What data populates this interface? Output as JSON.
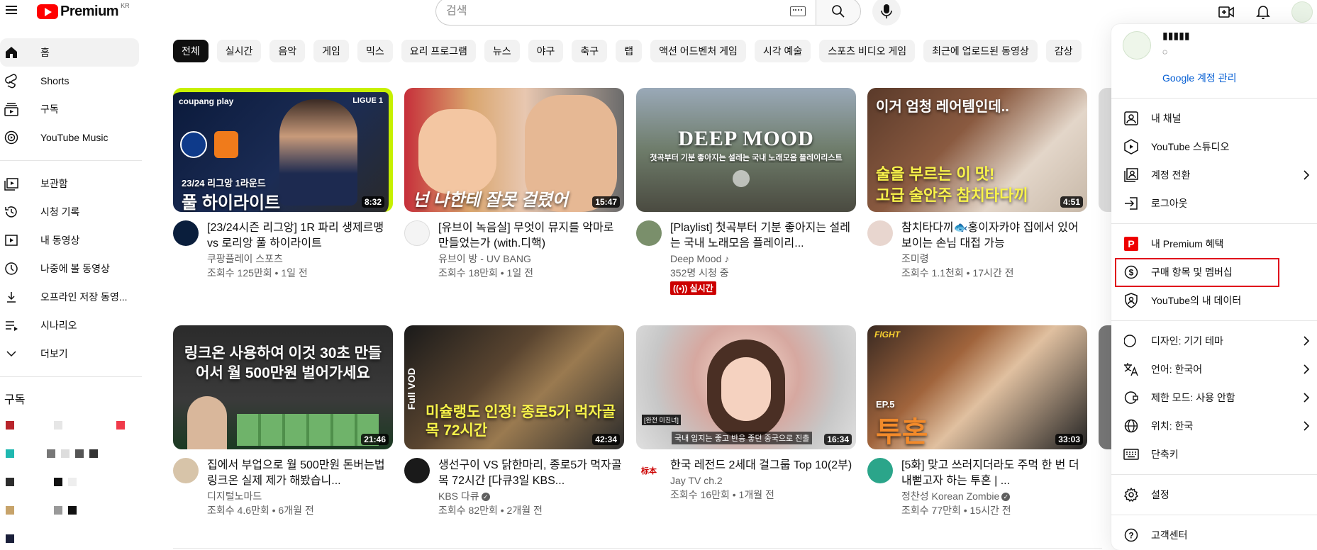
{
  "masthead": {
    "logo_text": "Premium",
    "logo_region": "KR",
    "search_placeholder": "검색",
    "icons": [
      "menu-icon",
      "keyboard-icon",
      "search-icon",
      "mic-icon",
      "create-video-icon",
      "bell-icon",
      "avatar"
    ]
  },
  "sidebar": {
    "items": [
      {
        "label": "홈",
        "icon": "home-icon",
        "active": true
      },
      {
        "label": "Shorts",
        "icon": "shorts-icon"
      },
      {
        "label": "구독",
        "icon": "subscriptions-icon"
      },
      {
        "label": "YouTube Music",
        "icon": "youtube-music-icon"
      }
    ],
    "library": [
      {
        "label": "보관함",
        "icon": "library-icon"
      },
      {
        "label": "시청 기록",
        "icon": "history-icon"
      },
      {
        "label": "내 동영상",
        "icon": "your-videos-icon"
      },
      {
        "label": "나중에 볼 동영상",
        "icon": "watch-later-icon"
      },
      {
        "label": "오프라인 저장 동영...",
        "icon": "download-icon"
      },
      {
        "label": "시나리오",
        "icon": "playlist-icon"
      },
      {
        "label": "더보기",
        "icon": "chevron-down-icon"
      }
    ],
    "subscriptions_title": "구독"
  },
  "chips": [
    "전체",
    "실시간",
    "음악",
    "게임",
    "믹스",
    "요리 프로그램",
    "뉴스",
    "야구",
    "축구",
    "랩",
    "액션 어드벤처 게임",
    "시각 예술",
    "스포츠 비디오 게임",
    "최근에 업로드된 동영상",
    "감상"
  ],
  "videos": [
    {
      "title": "[23/24시즌 리그앙] 1R 파리 생제르맹 vs 로리앙 풀 하이라이트",
      "channel": "쿠팡플레이 스포츠",
      "stats": "조회수 125만회 • 1일 전",
      "duration": "8:32",
      "thumb_text": "풀 하이라이트",
      "thumb_sub": "23/24 리그앙 1라운드",
      "thumb_brand": "coupang play",
      "thumb_league": "LIGUE 1"
    },
    {
      "title": "[유브이 녹음실] 무엇이 뮤지를 악마로 만들었는가 (with.디핵)",
      "channel": "유브이 방 - UV BANG",
      "stats": "조회수 18만회 • 1일 전",
      "duration": "15:47",
      "thumb_text": "넌 나한테 잘못 걸렸어"
    },
    {
      "title": "[Playlist] 첫곡부터 기분 좋아지는 설레는 국내 노래모음 플레이리...",
      "channel": "Deep Mood ♪",
      "stats": "352명 시청 중",
      "live": "실시간",
      "thumb_text": "DEEP MOOD",
      "thumb_sub": "첫곡부터 기분 좋아지는 설레는 국내 노래모음 플레이리스트"
    },
    {
      "title": "참치타다끼🐟홍이자카야 집에서 있어 보이는 손님 대접 가능",
      "channel": "조미령",
      "stats": "조회수 1.1천회 • 17시간 전",
      "duration": "4:51",
      "thumb_text": "고급 술안주 참치타다끼",
      "thumb_sub": "술을 부르는 이 맛!",
      "thumb_top": "이거 엄청 레어템인데.."
    },
    {
      "title": "집에서 부업으로 월 500만원 돈버는법 링크온 실제 제가 해봤습니...",
      "channel": "디지털노마드",
      "stats": "조회수 4.6만회 • 6개월 전",
      "duration": "21:46",
      "thumb_text": "링크온 사용하여 이것 30초 만들어서 월 500만원 벌어가세요"
    },
    {
      "title": "생선구이 VS 닭한마리, 종로5가 먹자골목 72시간 [다큐3일 KBS...",
      "channel": "KBS 다큐",
      "stats": "조회수 82만회 • 2개월 전",
      "duration": "42:34",
      "thumb_text": "미슐랭도 인정! 종로5가 먹자골목 72시간",
      "thumb_sub": "Full VOD"
    },
    {
      "title": "한국 레전드 2세대 걸그룹 Top 10(2부)",
      "channel": "Jay TV ch.2",
      "stats": "조회수 16만회 • 1개월 전",
      "duration": "16:34",
      "thumb_text": "국내 입지는 좋고 반응 좋던 중국으로 진출",
      "thumb_tag": "[완전 미친녀]"
    },
    {
      "title": "[5화] 맞고 쓰러지더라도 주먹 한 번 더 내뻗고자 하는 투혼 | ...",
      "channel": "정찬성 Korean Zombie",
      "stats": "조회수 77만회 • 15시간 전",
      "duration": "33:03",
      "thumb_text": "투혼",
      "thumb_sub": "EP.5"
    }
  ],
  "account_menu": {
    "manage_label": "Google 계정 관리",
    "groups": [
      [
        {
          "label": "내 채널",
          "icon": "person-icon"
        },
        {
          "label": "YouTube 스튜디오",
          "icon": "studio-icon"
        },
        {
          "label": "계정 전환",
          "icon": "switch-account-icon",
          "arrow": true
        },
        {
          "label": "로그아웃",
          "icon": "sign-out-icon"
        }
      ],
      [
        {
          "label": "내 Premium 혜택",
          "icon": "premium-icon"
        },
        {
          "label": "구매 항목 및 멤버십",
          "icon": "dollar-icon",
          "highlighted": true
        },
        {
          "label": "YouTube의 내 데이터",
          "icon": "shield-person-icon"
        }
      ],
      [
        {
          "label": "디자인: 기기 테마",
          "icon": "moon-icon",
          "arrow": true
        },
        {
          "label": "언어: 한국어",
          "icon": "translate-icon",
          "arrow": true
        },
        {
          "label": "제한 모드: 사용 안함",
          "icon": "restricted-icon",
          "arrow": true
        },
        {
          "label": "위치: 한국",
          "icon": "globe-icon",
          "arrow": true
        },
        {
          "label": "단축키",
          "icon": "keyboard-icon"
        }
      ],
      [
        {
          "label": "설정",
          "icon": "gear-icon"
        }
      ],
      [
        {
          "label": "고객센터",
          "icon": "help-icon"
        }
      ]
    ]
  },
  "colors": {
    "brand_red": "#ff0000",
    "link_blue": "#065fd4",
    "highlight_border": "#e0001b",
    "live_red": "#cc0000"
  }
}
